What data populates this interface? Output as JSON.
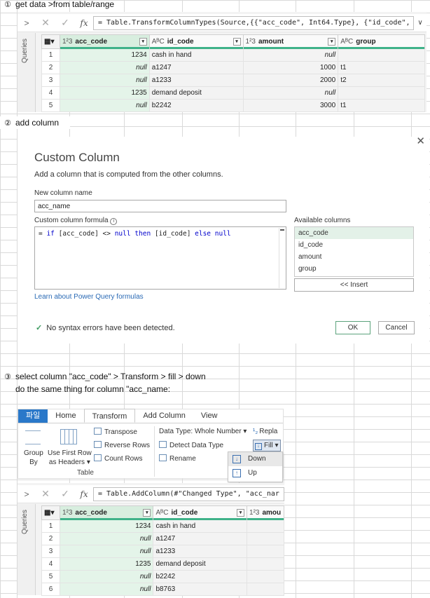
{
  "steps": {
    "s1": {
      "num": "①",
      "text": "get data >from table/range"
    },
    "s2": {
      "num": "②",
      "text": "add column"
    },
    "s3": {
      "num": "③",
      "text": "select column \"acc_code\" > Transform > fill > down"
    },
    "s3b": {
      "text": "do the same thing for column \"acc_name:"
    }
  },
  "panel1": {
    "formula": "= Table.TransformColumnTypes(Source,{{\"acc_code\", Int64.Type}, {\"id_code\",",
    "queries_label": "Queries",
    "columns": [
      {
        "type": "1²3",
        "name": "acc_code"
      },
      {
        "type": "AᴮC",
        "name": "id_code"
      },
      {
        "type": "1²3",
        "name": "amount"
      },
      {
        "type": "AᴮC",
        "name": "group"
      }
    ],
    "rows": [
      {
        "n": "1",
        "acc_code": "1234",
        "id_code": "cash in hand",
        "amount": "null",
        "group": ""
      },
      {
        "n": "2",
        "acc_code": "null",
        "id_code": "a1247",
        "amount": "1000",
        "group": "t1"
      },
      {
        "n": "3",
        "acc_code": "null",
        "id_code": "a1233",
        "amount": "2000",
        "group": "t2"
      },
      {
        "n": "4",
        "acc_code": "1235",
        "id_code": "demand deposit",
        "amount": "null",
        "group": ""
      },
      {
        "n": "5",
        "acc_code": "null",
        "id_code": "b2242",
        "amount": "3000",
        "group": "t1"
      }
    ]
  },
  "dialog": {
    "title": "Custom Column",
    "description": "Add a column that is computed from the other columns.",
    "name_label": "New column name",
    "name_value": "acc_name",
    "formula_label": "Custom column formula",
    "formula_parts": [
      "= ",
      "if",
      " [acc_code] <> ",
      "null",
      " ",
      "then",
      " [id_code] ",
      "else",
      " ",
      "null"
    ],
    "available_label": "Available columns",
    "available": [
      "acc_code",
      "id_code",
      "amount",
      "group"
    ],
    "insert": "<< Insert",
    "learn_link": "Learn about Power Query formulas",
    "status": "No syntax errors have been detected.",
    "ok": "OK",
    "cancel": "Cancel"
  },
  "ribbon": {
    "tabs": [
      "파일",
      "Home",
      "Transform",
      "Add Column",
      "View"
    ],
    "group_by": "Group\nBy",
    "group_by_1": "Group",
    "group_by_2": "By",
    "first_row_1": "Use First Row",
    "first_row_2": "as Headers",
    "transpose": "Transpose",
    "reverse_rows": "Reverse Rows",
    "count_rows": "Count Rows",
    "table_group": "Table",
    "data_type": "Data Type: Whole Number",
    "detect_type": "Detect Data Type",
    "rename": "Rename",
    "replace": "Repla",
    "fill": "Fill",
    "fill_down": "Down",
    "fill_up": "Up"
  },
  "panel2": {
    "formula": "= Table.AddColumn(#\"Changed Type\", \"acc_nar",
    "queries_label": "Queries",
    "columns": [
      {
        "type": "1²3",
        "name": "acc_code"
      },
      {
        "type": "AᴮC",
        "name": "id_code"
      },
      {
        "type": "1²3",
        "name": "amou"
      }
    ],
    "rows": [
      {
        "n": "1",
        "acc_code": "1234",
        "id_code": "cash in hand"
      },
      {
        "n": "2",
        "acc_code": "null",
        "id_code": "a1247"
      },
      {
        "n": "3",
        "acc_code": "null",
        "id_code": "a1233"
      },
      {
        "n": "4",
        "acc_code": "1235",
        "id_code": "demand deposit"
      },
      {
        "n": "5",
        "acc_code": "null",
        "id_code": "b2242"
      },
      {
        "n": "6",
        "acc_code": "null",
        "id_code": "b8763"
      }
    ]
  }
}
